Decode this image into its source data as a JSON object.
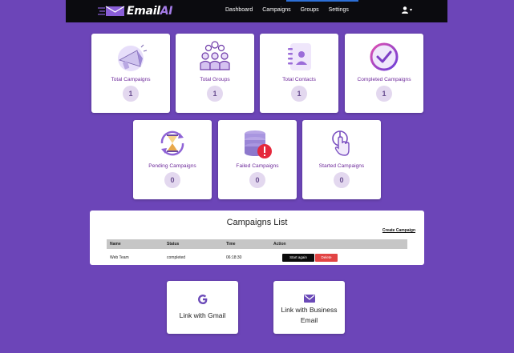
{
  "brand": {
    "name_main": "Email",
    "name_accent": "AI"
  },
  "nav": {
    "links": [
      "Dashboard",
      "Campaigns",
      "Groups",
      "Settings"
    ]
  },
  "user_menu": {
    "icon": "user-icon",
    "caret": "▾"
  },
  "stats": [
    {
      "label": "Total Campaigns",
      "value": "1",
      "icon": "megaphone-icon"
    },
    {
      "label": "Total Groups",
      "value": "1",
      "icon": "group-icon"
    },
    {
      "label": "Total Contacts",
      "value": "1",
      "icon": "contact-book-icon"
    },
    {
      "label": "Completed Campaigns",
      "value": "1",
      "icon": "check-circle-icon"
    },
    {
      "label": "Pending Campaigns",
      "value": "0",
      "icon": "hourglass-icon"
    },
    {
      "label": "Failed Campaigns",
      "value": "0",
      "icon": "database-error-icon"
    },
    {
      "label": "Started Campaigns",
      "value": "0",
      "icon": "power-touch-icon"
    }
  ],
  "campaigns": {
    "title": "Campaigns List",
    "create_label": "Create Campaign",
    "columns": [
      "Name",
      "Status",
      "Time",
      "Action"
    ],
    "rows": [
      {
        "name": "Web Team",
        "status": "completed",
        "time": "06:18:30",
        "start_label": "Start again",
        "delete_label": "Delete"
      }
    ]
  },
  "links": {
    "gmail": {
      "label": "Link with Gmail",
      "icon": "google-icon"
    },
    "business": {
      "label_line1": "Link with Business",
      "label_line2": "Email",
      "icon": "envelope-icon"
    }
  },
  "colors": {
    "background": "#6c45b8",
    "navbar": "#0b0b0f",
    "accent_purple": "#6e2a9b",
    "delete_red": "#e24444"
  }
}
